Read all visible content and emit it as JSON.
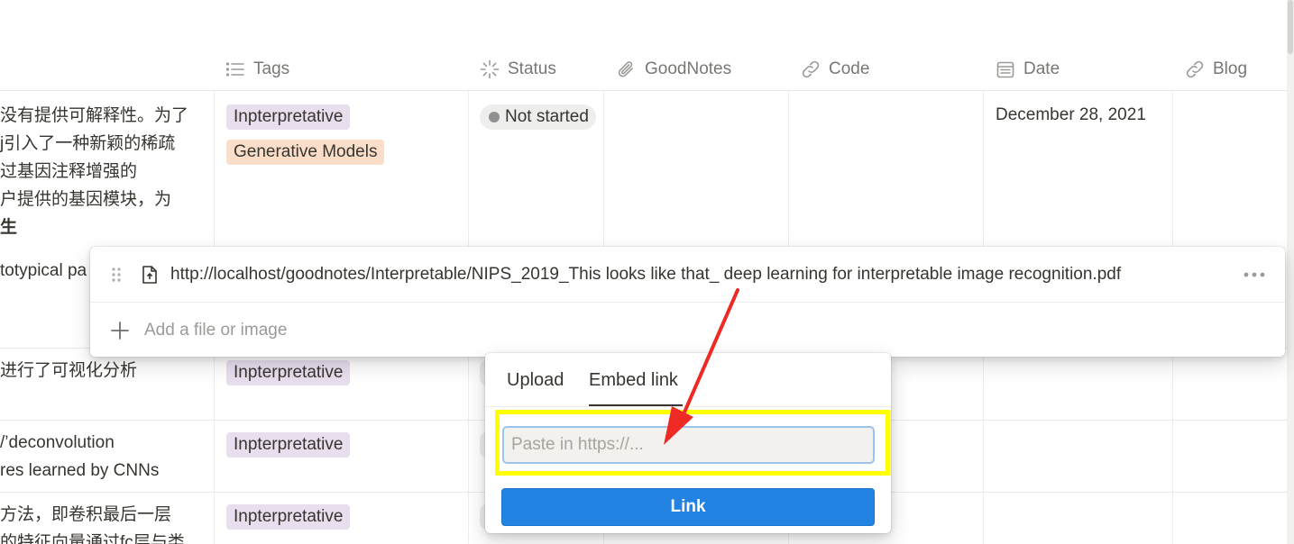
{
  "columns": [
    {
      "name": "Tags",
      "icon": "list-icon"
    },
    {
      "name": "Status",
      "icon": "status-loader-icon"
    },
    {
      "name": "GoodNotes",
      "icon": "paperclip-icon"
    },
    {
      "name": "Code",
      "icon": "link-icon"
    },
    {
      "name": "Date",
      "icon": "calendar-icon"
    },
    {
      "name": "Blog",
      "icon": "link-icon"
    }
  ],
  "rows": [
    {
      "text_lines": [
        "没有提供可解释性。为了",
        "j引入了一种新颖的稀疏",
        "过基因注释增强的",
        "户提供的基因模块，为",
        "生"
      ],
      "tags": [
        {
          "label": "Inpterpretative",
          "color": "#e8deee"
        },
        {
          "label": "Generative Models",
          "color": "#fadec9"
        }
      ],
      "status": "Not started",
      "date": "December 28, 2021"
    },
    {
      "text_lines": [
        "totypical pa"
      ]
    },
    {
      "text_lines": [
        "进行了可视化分析"
      ],
      "tags": [
        {
          "label": "Inpterpretative",
          "color": "#e8deee"
        }
      ]
    },
    {
      "text_lines": [
        "/’deconvolution",
        "res learned by CNNs"
      ],
      "tags": [
        {
          "label": "Inpterpretative",
          "color": "#e8deee"
        }
      ]
    },
    {
      "text_lines": [
        "方法，即卷积最后一层",
        "的特征向量通过fc层与类"
      ],
      "tags": [
        {
          "label": "Inpterpretative",
          "color": "#e8deee"
        }
      ]
    }
  ],
  "file_popup": {
    "file_url": "http://localhost/goodnotes/Interpretable/NIPS_2019_This looks like that_ deep learning for interpretable image recognition.pdf",
    "add_label": "Add a file or image"
  },
  "embed_popup": {
    "tabs": [
      "Upload",
      "Embed link"
    ],
    "active_tab": "Embed link",
    "input_placeholder": "Paste in https://...",
    "input_value": "",
    "link_button": "Link"
  },
  "colors": {
    "accent": "#2383e2",
    "highlight": "#ffff00",
    "annotation_arrow": "#ee2a24"
  }
}
